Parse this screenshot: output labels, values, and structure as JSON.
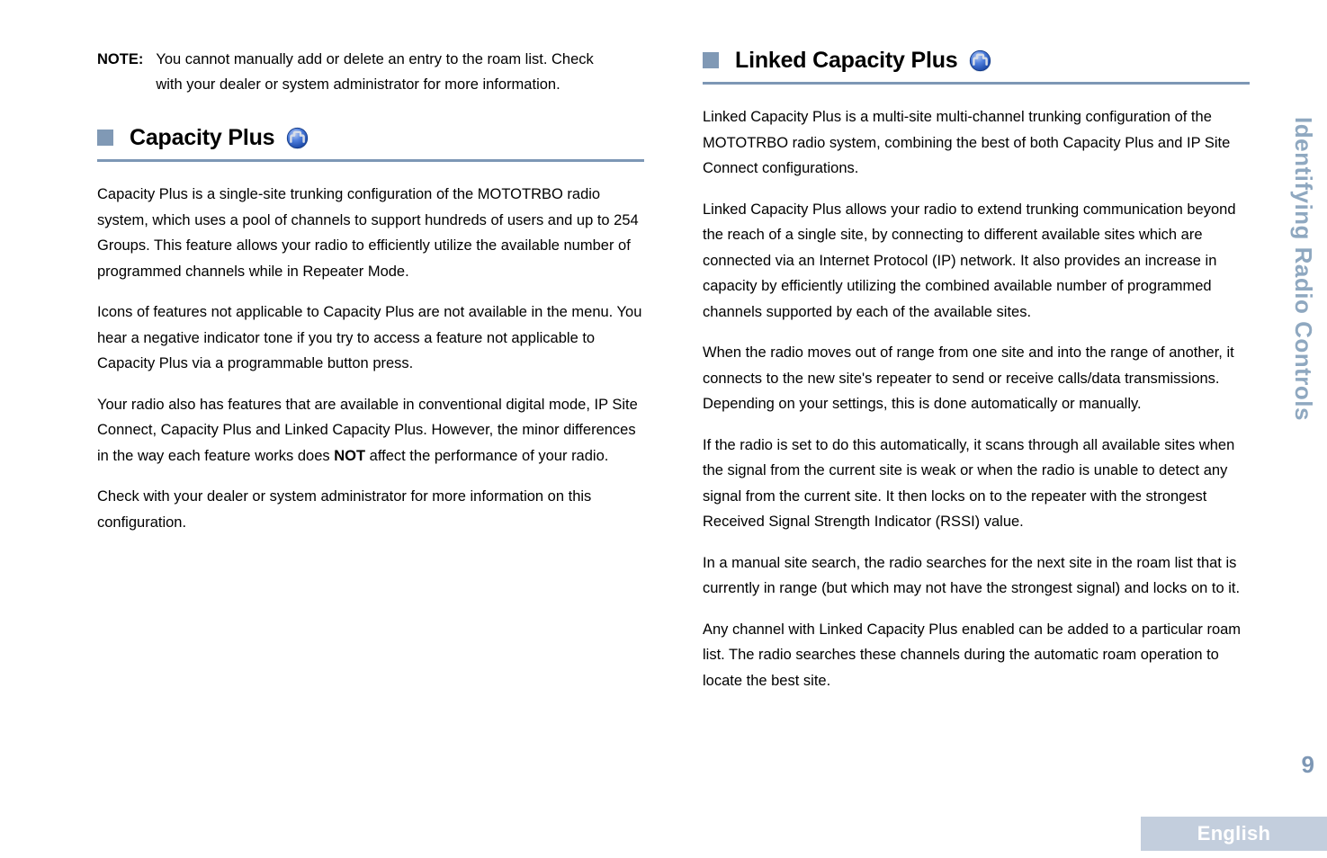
{
  "document": {
    "page_number": "9",
    "language_footer": "English",
    "side_tab_label": "Identifying Radio Controls",
    "colors": {
      "accent_blue_gray": "#7d97b5",
      "marker_square": "#8099b5",
      "side_tab_text": "#8fa8c0",
      "language_bar_bg": "#c3cedd",
      "icon_blue": "#2a5fd0"
    }
  },
  "left_column": {
    "note": {
      "label": "NOTE:",
      "text": "You cannot manually add or delete an entry to the roam list. Check with your dealer or system administrator for more information."
    },
    "section": {
      "title": "Capacity Plus",
      "icon": "capacity-plus-icon",
      "paragraphs": [
        "Capacity Plus is a single-site trunking configuration of the MOTOTRBO radio system, which uses a pool of channels to support hundreds of users and up to 254 Groups. This feature allows your radio to efficiently utilize the available number of programmed channels while in Repeater Mode.",
        "Icons of features not applicable to Capacity Plus are not available in the menu. You hear a negative indicator tone if you try to access a feature not applicable to Capacity Plus via a programmable button press.",
        "Check with your dealer or system administrator for more information on this configuration."
      ],
      "paragraph_with_emphasis": {
        "before": "Your radio also has features that are available in conventional digital mode, IP Site Connect, Capacity Plus and Linked Capacity Plus. However, the minor differences in the way each feature works does ",
        "emphasis": "NOT",
        "after": " affect the performance of your radio."
      }
    }
  },
  "right_column": {
    "section": {
      "title": "Linked Capacity Plus",
      "icon": "linked-capacity-plus-icon",
      "paragraphs": [
        "Linked Capacity Plus is a multi-site multi-channel trunking configuration of the MOTOTRBO radio system, combining the best of both Capacity Plus and IP Site Connect configurations.",
        "Linked Capacity Plus allows your radio to extend trunking communication beyond the reach of a single site, by connecting to different available sites which are connected via an Internet Protocol (IP) network. It also provides an increase in capacity by efficiently utilizing the combined available number of programmed channels supported by each of the available sites.",
        "When the radio moves out of range from one site and into the range of another, it connects to the new site's repeater to send or receive calls/data transmissions. Depending on your settings, this is done automatically or manually.",
        "If the radio is set to do this automatically, it scans through all available sites when the signal from the current site is weak or when the radio is unable to detect any signal from the current site. It then locks on to the repeater with the strongest Received Signal Strength Indicator (RSSI) value.",
        "In a manual site search, the radio searches for the next site in the roam list that is currently in range (but which may not have the strongest signal) and locks on to it.",
        "Any channel with Linked Capacity Plus enabled can be added to a particular roam list. The radio searches these channels during the automatic roam operation to locate the best site."
      ]
    }
  }
}
